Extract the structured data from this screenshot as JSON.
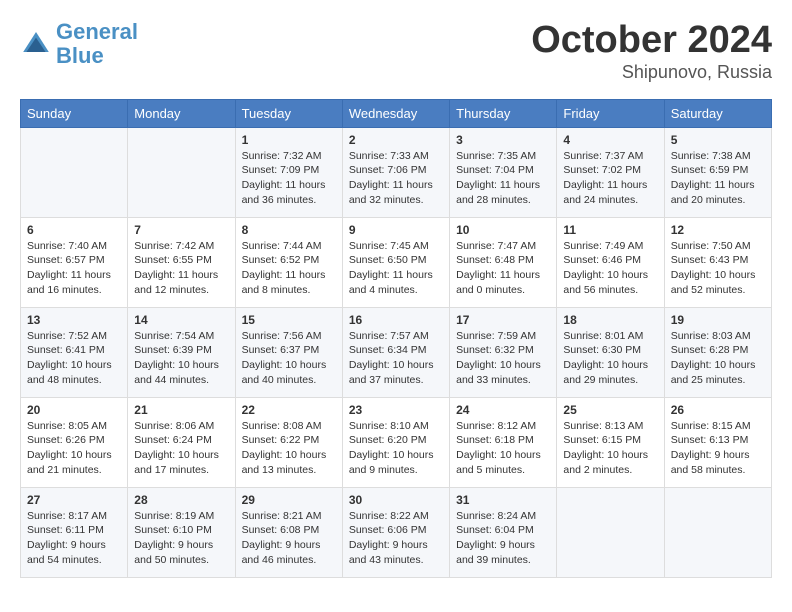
{
  "header": {
    "logo_line1": "General",
    "logo_line2": "Blue",
    "month": "October 2024",
    "location": "Shipunovo, Russia"
  },
  "weekdays": [
    "Sunday",
    "Monday",
    "Tuesday",
    "Wednesday",
    "Thursday",
    "Friday",
    "Saturday"
  ],
  "weeks": [
    [
      {
        "day": "",
        "info": ""
      },
      {
        "day": "",
        "info": ""
      },
      {
        "day": "1",
        "info": "Sunrise: 7:32 AM\nSunset: 7:09 PM\nDaylight: 11 hours\nand 36 minutes."
      },
      {
        "day": "2",
        "info": "Sunrise: 7:33 AM\nSunset: 7:06 PM\nDaylight: 11 hours\nand 32 minutes."
      },
      {
        "day": "3",
        "info": "Sunrise: 7:35 AM\nSunset: 7:04 PM\nDaylight: 11 hours\nand 28 minutes."
      },
      {
        "day": "4",
        "info": "Sunrise: 7:37 AM\nSunset: 7:02 PM\nDaylight: 11 hours\nand 24 minutes."
      },
      {
        "day": "5",
        "info": "Sunrise: 7:38 AM\nSunset: 6:59 PM\nDaylight: 11 hours\nand 20 minutes."
      }
    ],
    [
      {
        "day": "6",
        "info": "Sunrise: 7:40 AM\nSunset: 6:57 PM\nDaylight: 11 hours\nand 16 minutes."
      },
      {
        "day": "7",
        "info": "Sunrise: 7:42 AM\nSunset: 6:55 PM\nDaylight: 11 hours\nand 12 minutes."
      },
      {
        "day": "8",
        "info": "Sunrise: 7:44 AM\nSunset: 6:52 PM\nDaylight: 11 hours\nand 8 minutes."
      },
      {
        "day": "9",
        "info": "Sunrise: 7:45 AM\nSunset: 6:50 PM\nDaylight: 11 hours\nand 4 minutes."
      },
      {
        "day": "10",
        "info": "Sunrise: 7:47 AM\nSunset: 6:48 PM\nDaylight: 11 hours\nand 0 minutes."
      },
      {
        "day": "11",
        "info": "Sunrise: 7:49 AM\nSunset: 6:46 PM\nDaylight: 10 hours\nand 56 minutes."
      },
      {
        "day": "12",
        "info": "Sunrise: 7:50 AM\nSunset: 6:43 PM\nDaylight: 10 hours\nand 52 minutes."
      }
    ],
    [
      {
        "day": "13",
        "info": "Sunrise: 7:52 AM\nSunset: 6:41 PM\nDaylight: 10 hours\nand 48 minutes."
      },
      {
        "day": "14",
        "info": "Sunrise: 7:54 AM\nSunset: 6:39 PM\nDaylight: 10 hours\nand 44 minutes."
      },
      {
        "day": "15",
        "info": "Sunrise: 7:56 AM\nSunset: 6:37 PM\nDaylight: 10 hours\nand 40 minutes."
      },
      {
        "day": "16",
        "info": "Sunrise: 7:57 AM\nSunset: 6:34 PM\nDaylight: 10 hours\nand 37 minutes."
      },
      {
        "day": "17",
        "info": "Sunrise: 7:59 AM\nSunset: 6:32 PM\nDaylight: 10 hours\nand 33 minutes."
      },
      {
        "day": "18",
        "info": "Sunrise: 8:01 AM\nSunset: 6:30 PM\nDaylight: 10 hours\nand 29 minutes."
      },
      {
        "day": "19",
        "info": "Sunrise: 8:03 AM\nSunset: 6:28 PM\nDaylight: 10 hours\nand 25 minutes."
      }
    ],
    [
      {
        "day": "20",
        "info": "Sunrise: 8:05 AM\nSunset: 6:26 PM\nDaylight: 10 hours\nand 21 minutes."
      },
      {
        "day": "21",
        "info": "Sunrise: 8:06 AM\nSunset: 6:24 PM\nDaylight: 10 hours\nand 17 minutes."
      },
      {
        "day": "22",
        "info": "Sunrise: 8:08 AM\nSunset: 6:22 PM\nDaylight: 10 hours\nand 13 minutes."
      },
      {
        "day": "23",
        "info": "Sunrise: 8:10 AM\nSunset: 6:20 PM\nDaylight: 10 hours\nand 9 minutes."
      },
      {
        "day": "24",
        "info": "Sunrise: 8:12 AM\nSunset: 6:18 PM\nDaylight: 10 hours\nand 5 minutes."
      },
      {
        "day": "25",
        "info": "Sunrise: 8:13 AM\nSunset: 6:15 PM\nDaylight: 10 hours\nand 2 minutes."
      },
      {
        "day": "26",
        "info": "Sunrise: 8:15 AM\nSunset: 6:13 PM\nDaylight: 9 hours\nand 58 minutes."
      }
    ],
    [
      {
        "day": "27",
        "info": "Sunrise: 8:17 AM\nSunset: 6:11 PM\nDaylight: 9 hours\nand 54 minutes."
      },
      {
        "day": "28",
        "info": "Sunrise: 8:19 AM\nSunset: 6:10 PM\nDaylight: 9 hours\nand 50 minutes."
      },
      {
        "day": "29",
        "info": "Sunrise: 8:21 AM\nSunset: 6:08 PM\nDaylight: 9 hours\nand 46 minutes."
      },
      {
        "day": "30",
        "info": "Sunrise: 8:22 AM\nSunset: 6:06 PM\nDaylight: 9 hours\nand 43 minutes."
      },
      {
        "day": "31",
        "info": "Sunrise: 8:24 AM\nSunset: 6:04 PM\nDaylight: 9 hours\nand 39 minutes."
      },
      {
        "day": "",
        "info": ""
      },
      {
        "day": "",
        "info": ""
      }
    ]
  ]
}
